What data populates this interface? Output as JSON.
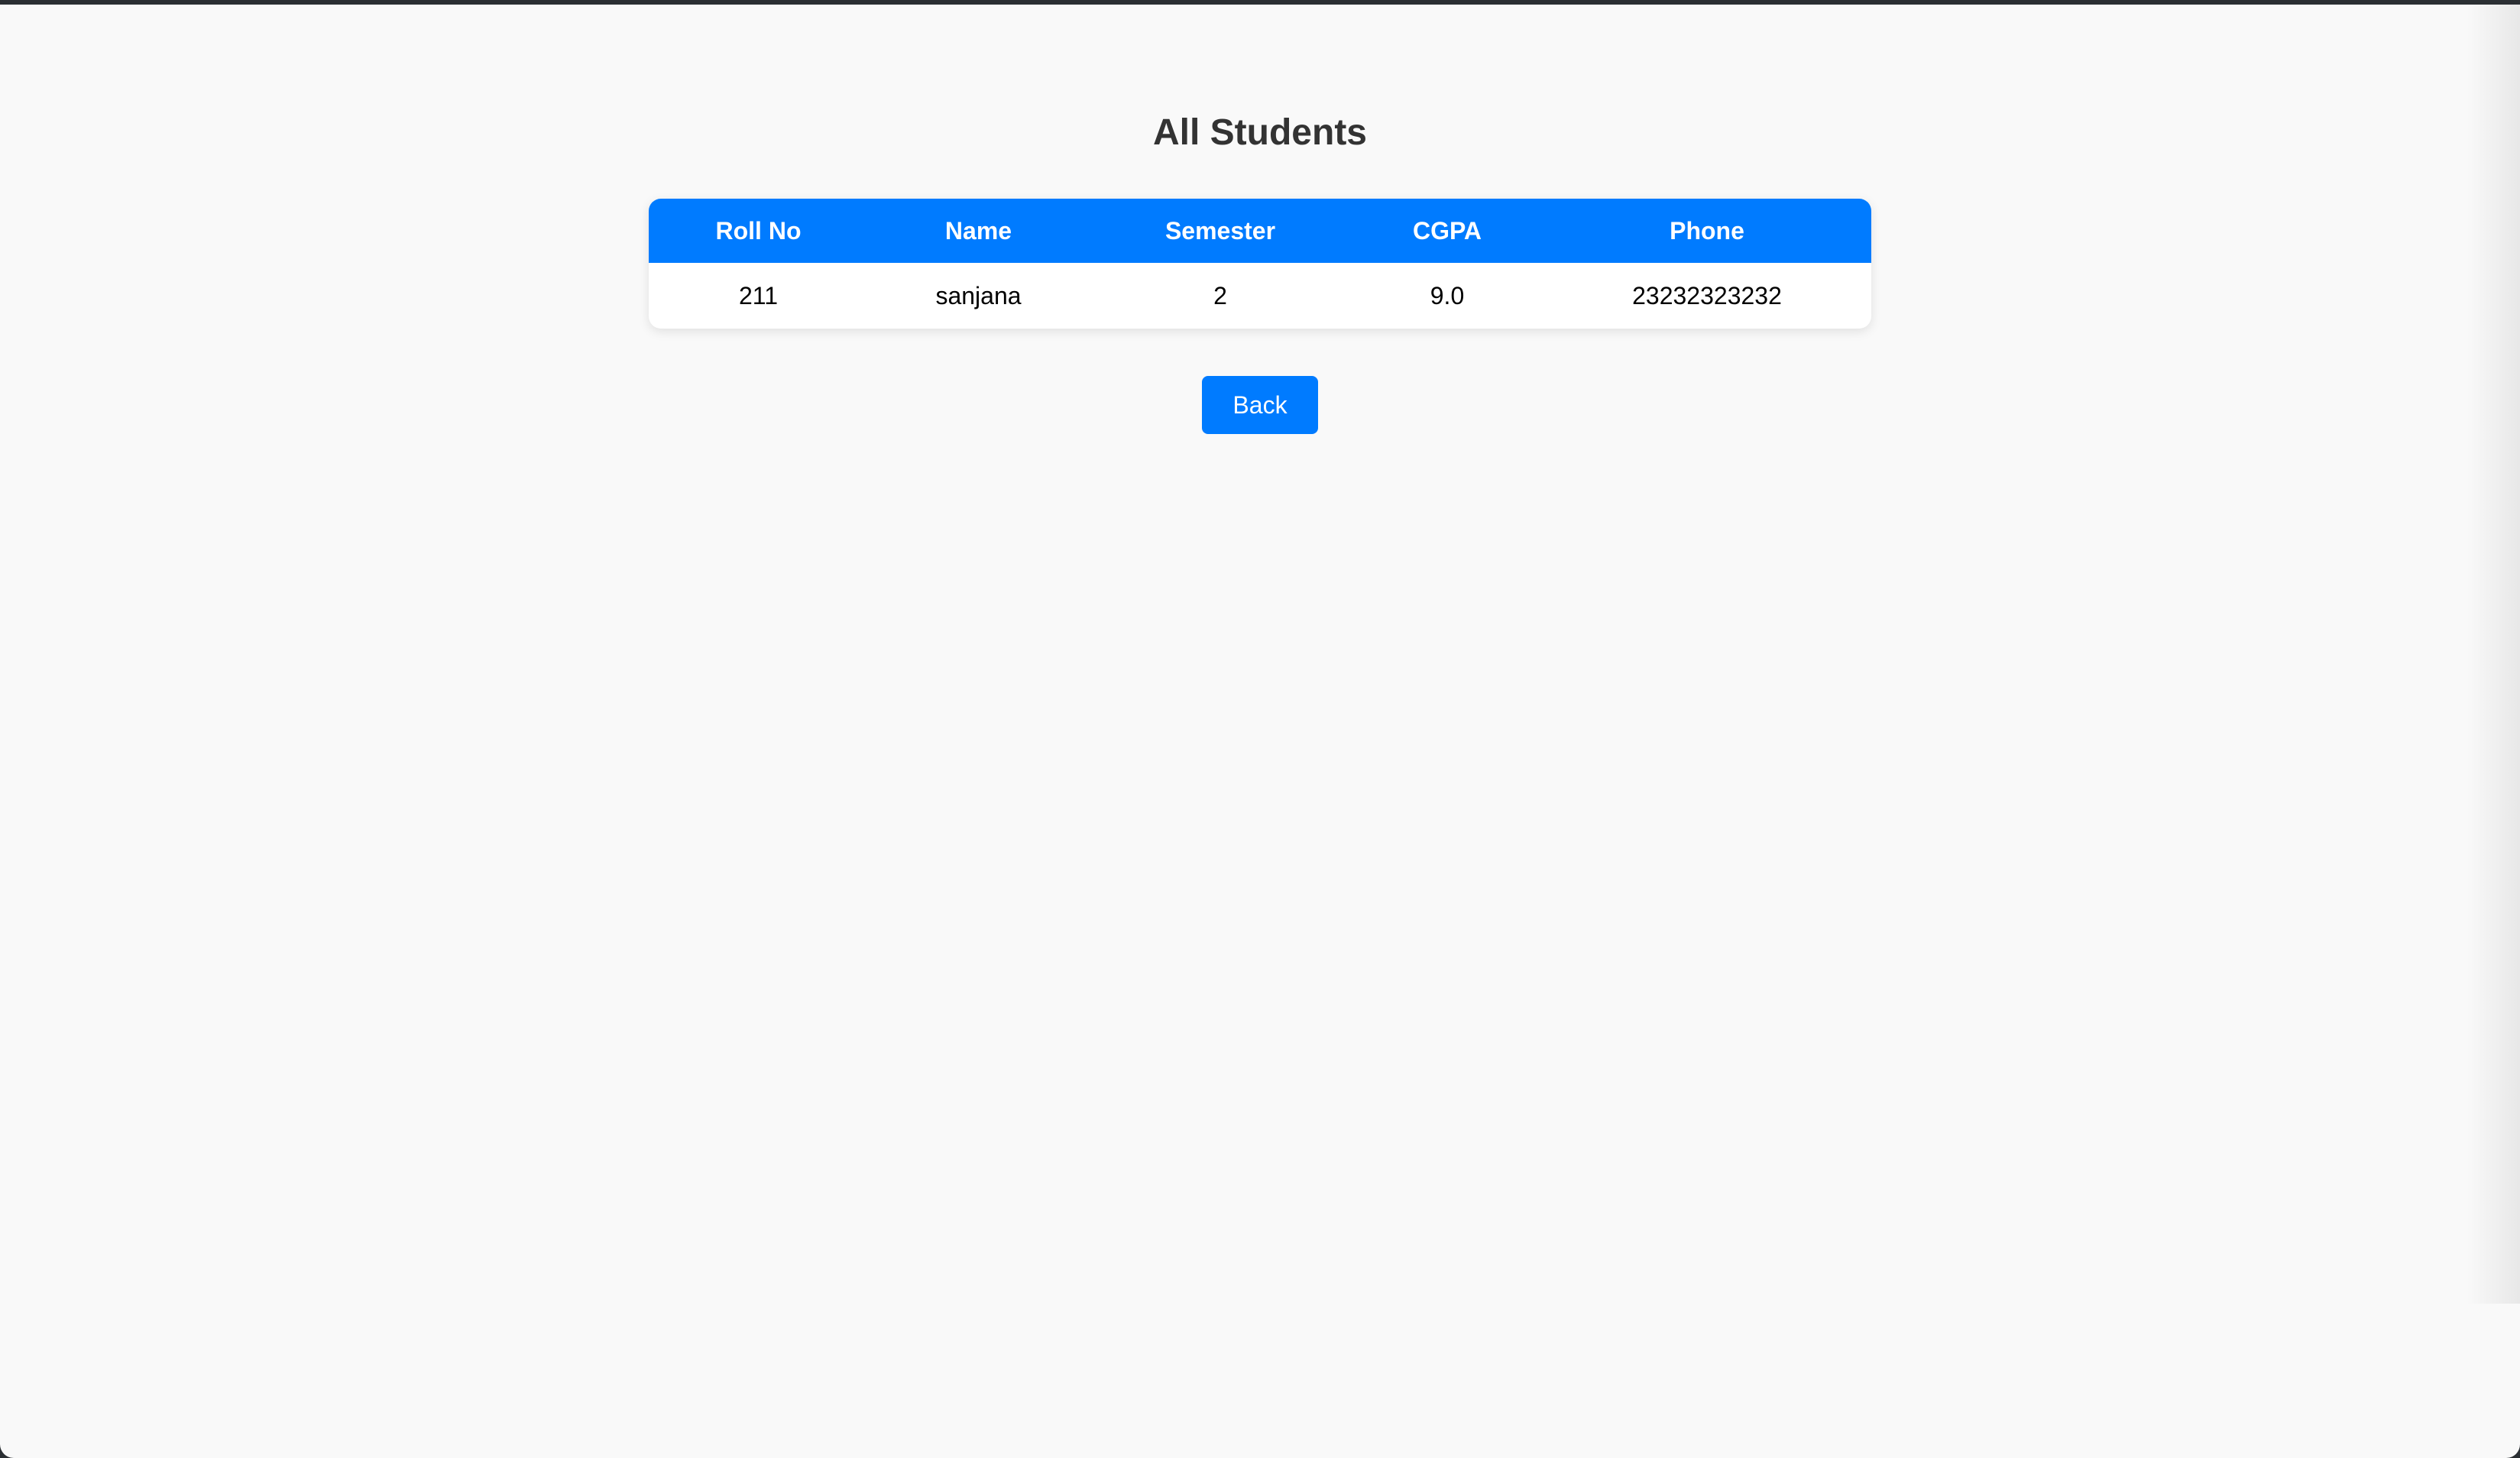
{
  "page": {
    "title": "All Students"
  },
  "table": {
    "headers": [
      "Roll No",
      "Name",
      "Semester",
      "CGPA",
      "Phone"
    ],
    "rows": [
      [
        "211",
        "sanjana",
        "2",
        "9.0",
        "23232323232"
      ]
    ]
  },
  "actions": {
    "back_label": "Back"
  },
  "colors": {
    "accent": "#007bff",
    "background": "#f9f9f9",
    "title_text": "#333333"
  }
}
